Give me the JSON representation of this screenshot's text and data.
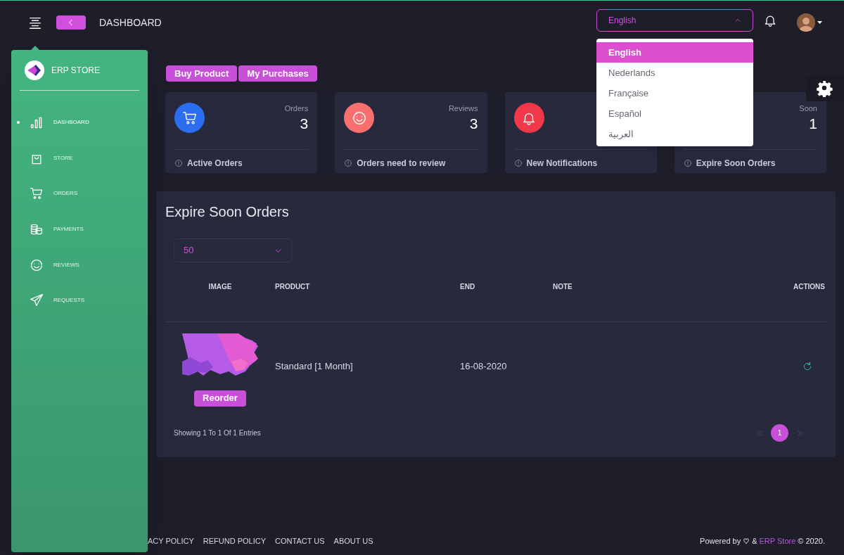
{
  "header": {
    "title": "DASHBOARD",
    "language_select": {
      "value": "English",
      "expanded": true
    }
  },
  "language_options": [
    {
      "label": "English",
      "selected": true
    },
    {
      "label": "Nederlands",
      "selected": false
    },
    {
      "label": "Française",
      "selected": false
    },
    {
      "label": "Español",
      "selected": false
    },
    {
      "label": "العربية",
      "selected": false
    }
  ],
  "sidebar": {
    "brand": "ERP STORE",
    "items": [
      {
        "label": "DASHBOARD",
        "selected": true
      },
      {
        "label": "STORE",
        "selected": false
      },
      {
        "label": "ORDERS",
        "selected": false
      },
      {
        "label": "PAYMENTS",
        "selected": false
      },
      {
        "label": "REVIEWS",
        "selected": false
      },
      {
        "label": "REQUESTS",
        "selected": false
      }
    ]
  },
  "actions": [
    "Buy Product",
    "My Purchases"
  ],
  "cards": [
    {
      "label": "Orders",
      "value": "3",
      "caption": "Active Orders",
      "color": "#2d6df0"
    },
    {
      "label": "Reviews",
      "value": "3",
      "caption": "Orders need to review",
      "color": "#f7706e"
    },
    {
      "caption": "New Notifications",
      "color": "#f0384a"
    },
    {
      "label": "Soon",
      "value": "1",
      "caption": "Expire Soon Orders"
    }
  ],
  "table": {
    "title": "Expire Soon Orders",
    "page_size": "50",
    "columns": [
      "IMAGE",
      "PRODUCT",
      "END",
      "NOTE",
      "ACTIONS"
    ],
    "rows": [
      {
        "button": "Reorder",
        "product": "Standard [1 Month]",
        "end": "16-08-2020"
      }
    ],
    "summary": "Showing 1 To 1 Of 1 Entries",
    "pages": [
      {
        "label": "1",
        "selected": true
      }
    ]
  },
  "footer": {
    "links": [
      "ACY POLICY",
      "REFUND POLICY",
      "CONTACT US",
      "ABOUT US"
    ],
    "credit_prefix": "Powered by",
    "credit_joiner": "&",
    "credit_link": "ERP Store",
    "credit_suffix": "© 2020."
  }
}
